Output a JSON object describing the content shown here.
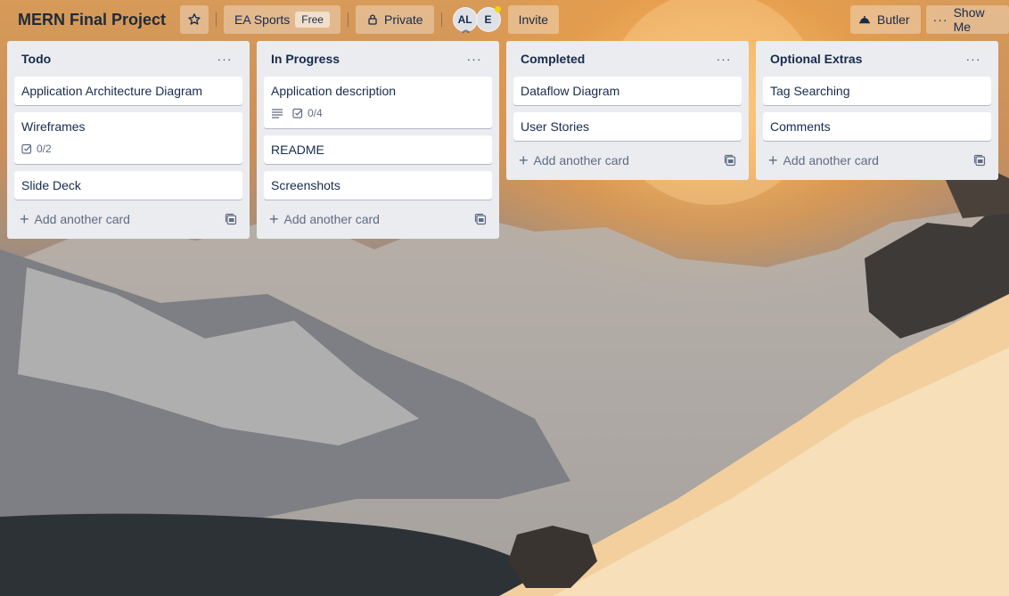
{
  "board": {
    "title": "MERN Final Project",
    "workspace": "EA Sports",
    "workspace_badge": "Free",
    "visibility": "Private",
    "invite_label": "Invite",
    "butler_label": "Butler",
    "show_menu_label": "Show Me",
    "members": [
      {
        "initials": "AL"
      },
      {
        "initials": "E"
      }
    ]
  },
  "add_card_label": "Add another card",
  "lists": [
    {
      "title": "Todo",
      "cards": [
        {
          "title": "Application Architecture Diagram"
        },
        {
          "title": "Wireframes",
          "checklist": "0/2"
        },
        {
          "title": "Slide Deck"
        }
      ]
    },
    {
      "title": "In Progress",
      "cards": [
        {
          "title": "Application description",
          "has_description": true,
          "checklist": "0/4"
        },
        {
          "title": "README"
        },
        {
          "title": "Screenshots"
        }
      ]
    },
    {
      "title": "Completed",
      "cards": [
        {
          "title": "Dataflow Diagram"
        },
        {
          "title": "User Stories"
        }
      ]
    },
    {
      "title": "Optional Extras",
      "cards": [
        {
          "title": "Tag Searching"
        },
        {
          "title": "Comments"
        }
      ]
    }
  ],
  "icons": {
    "star": "star-icon",
    "lock": "lock-icon",
    "butler": "butler-bell-icon",
    "more": "ellipsis-icon",
    "description": "description-lines-icon",
    "checklist": "checklist-icon",
    "template": "card-template-icon",
    "plus": "plus-icon"
  },
  "colors": {
    "list_bg": "#ebecf0",
    "card_bg": "#ffffff",
    "text": "#172b4d",
    "muted": "#5e6c84"
  }
}
